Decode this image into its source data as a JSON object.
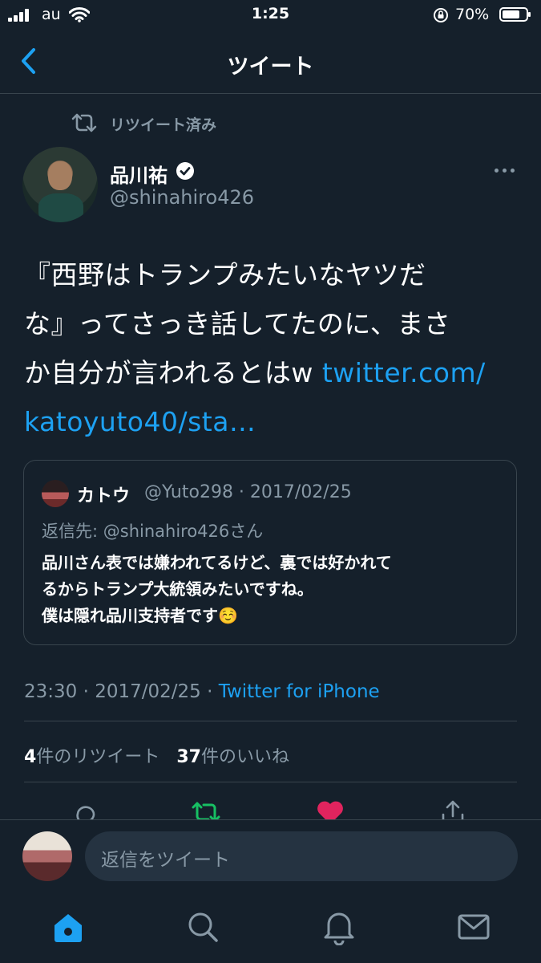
{
  "status_bar": {
    "carrier": "au",
    "time": "1:25",
    "battery": "70%"
  },
  "header": {
    "title": "ツイート"
  },
  "retweet_context": {
    "label": "リツイート済み"
  },
  "author": {
    "name": "品川祐",
    "handle": "@shinahiro426",
    "verified": true
  },
  "tweet": {
    "lines": [
      "『西野はトランプみたいなヤツだ",
      "な』ってさっき話してたのに、まさ",
      "か自分が言われるとはw "
    ],
    "link_part1": "twitter.com/",
    "link_part2": "katoyuto40/sta…"
  },
  "quoted": {
    "name": "カトウ",
    "handle_date": "@Yuto298 · 2017/02/25",
    "reply_to": "返信先: @shinahiro426さん",
    "lines": [
      "品川さん表では嫌われてるけど、裏では好かれて",
      "るからトランプ大統領みたいですね。",
      "僕は隠れ品川支持者です"
    ],
    "emoji": "☺️"
  },
  "meta": {
    "time_date": "23:30 · 2017/02/25 · ",
    "source": "Twitter for iPhone"
  },
  "stats": {
    "retweets_count": "4",
    "retweets_label": "件のリツイート",
    "likes_count": "37",
    "likes_label": "件のいいね"
  },
  "reply_input": {
    "placeholder": "返信をツイート"
  },
  "colors": {
    "background": "#15202b",
    "accent": "#1da1f2",
    "retweet": "#17bf63",
    "like": "#e0245e",
    "muted": "#8899a6"
  }
}
